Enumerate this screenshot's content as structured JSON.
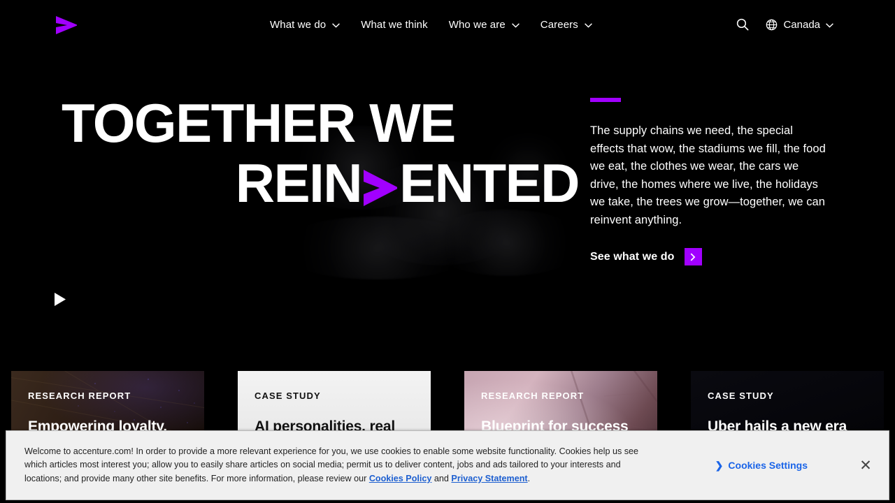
{
  "brand": {
    "logo_name": "accenture-chevron-logo",
    "accent_color": "#a100ff"
  },
  "header": {
    "nav": [
      {
        "label": "What we do",
        "has_dropdown": true
      },
      {
        "label": "What we think",
        "has_dropdown": false
      },
      {
        "label": "Who we are",
        "has_dropdown": true
      },
      {
        "label": "Careers",
        "has_dropdown": true
      }
    ],
    "search_icon": "search-icon",
    "globe_icon": "globe-icon",
    "locale": "Canada"
  },
  "hero": {
    "title_line_1": "TOGETHER WE",
    "title_line_2_before": "REIN",
    "title_line_2_after": "ENTED",
    "title_full": "TOGETHER WE REINVENTED",
    "paragraph": "The supply chains we need, the special effects that wow, the stadiums we fill, the food we eat, the clothes we wear, the cars we drive, the homes where we live, the holidays we take, the trees we grow—together, we can reinvent anything.",
    "cta_label": "See what we do",
    "cta_icon": "chevron-right-icon",
    "play_icon": "play-icon"
  },
  "cards": [
    {
      "eyebrow": "RESEARCH REPORT",
      "title": "Empowering loyalty,",
      "theme": "dark",
      "bg": "bg-0"
    },
    {
      "eyebrow": "CASE STUDY",
      "title": "AI personalities, real",
      "theme": "light",
      "bg": "bg-1"
    },
    {
      "eyebrow": "RESEARCH REPORT",
      "title": "Blueprint for success",
      "theme": "dark",
      "bg": "bg-2"
    },
    {
      "eyebrow": "CASE STUDY",
      "title": "Uber hails a new era for",
      "theme": "dark",
      "bg": "bg-3"
    }
  ],
  "cookie_banner": {
    "text_part_1": "Welcome to accenture.com! In order to provide a more relevant experience for you, we use cookies to enable some website functionality. Cookies help us see which articles most interest you; allow you to easily share articles on social media; permit us to deliver content, jobs and ads tailored to your interests and locations; and provide many other site benefits. For more information, please review our ",
    "link_cookies_policy": "Cookies Policy",
    "text_and": " and ",
    "link_privacy_statement": "Privacy Statement",
    "text_period": ".",
    "settings_label": "Cookies Settings",
    "settings_chevron": "❯",
    "close_icon": "close-icon",
    "close_glyph": "✕",
    "link_color": "#1a64e8"
  }
}
